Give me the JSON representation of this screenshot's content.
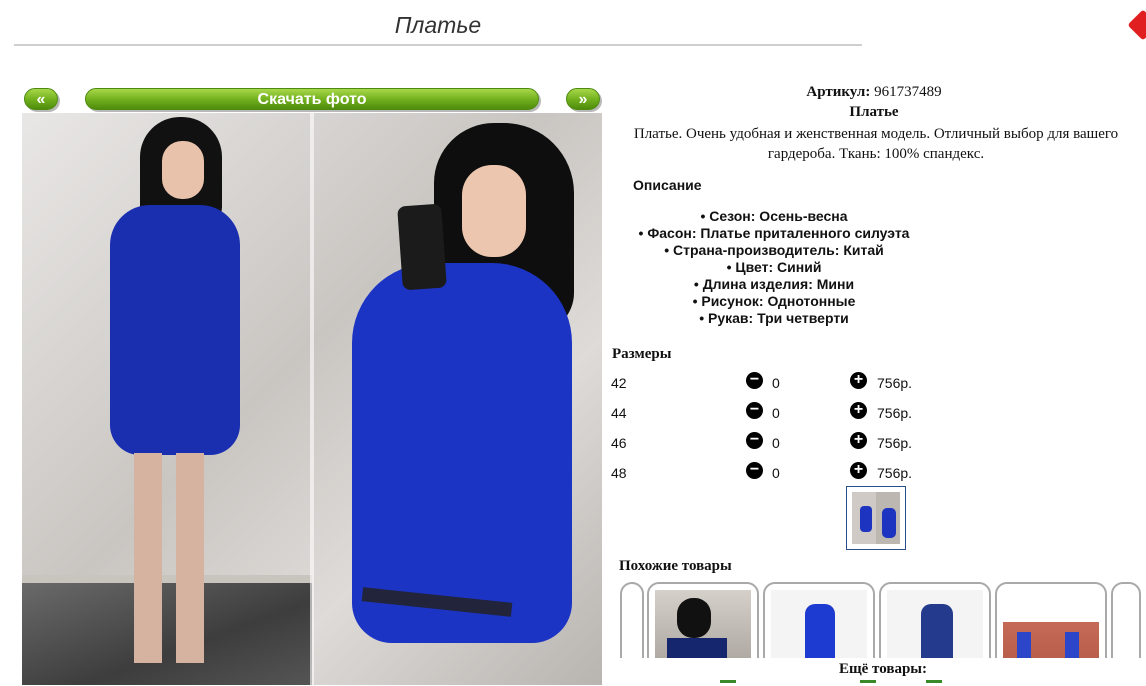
{
  "page": {
    "title": "Платье"
  },
  "gallery": {
    "prev_label": "«",
    "download_label": "Скачать фото",
    "next_label": "»"
  },
  "product": {
    "sku_label": "Артикул:",
    "sku_value": "961737489",
    "name": "Платье",
    "description": "Платье. Очень удобная и женственная модель. Отличный выбор для вашего гардероба. Ткань: 100% спандекс."
  },
  "details": {
    "heading": "Описание",
    "attributes": [
      "Сезон: Осень-весна",
      "Фасон: Платье приталенного силуэта",
      "Страна-производитель: Китай",
      "Цвет: Синий",
      "Длина изделия: Мини",
      "Рисунок: Однотонные",
      "Рукав: Три четверти"
    ]
  },
  "sizes": {
    "heading": "Размеры",
    "minus_icon": "minus-circle-icon",
    "plus_icon": "plus-circle-icon",
    "rows": [
      {
        "size": "42",
        "qty": "0",
        "price": "756р."
      },
      {
        "size": "44",
        "qty": "0",
        "price": "756р."
      },
      {
        "size": "46",
        "qty": "0",
        "price": "756р."
      },
      {
        "size": "48",
        "qty": "0",
        "price": "756р."
      }
    ]
  },
  "similar": {
    "heading": "Похожие товары"
  },
  "more": {
    "label": "Ещё товары:"
  },
  "colors": {
    "accent_green": "#6fae1c",
    "dress_blue": "#1c34c4",
    "thumb_border": "#2b4f8c"
  }
}
